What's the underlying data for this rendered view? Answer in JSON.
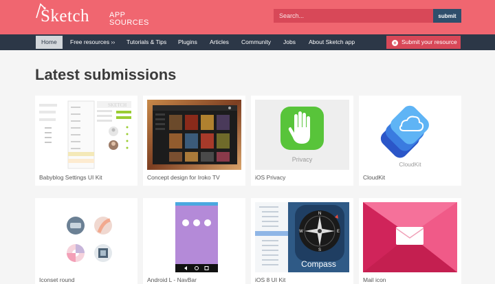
{
  "header": {
    "logo": {
      "word": "Sketch",
      "sub1": "APP",
      "sub2": "SOURCES"
    },
    "search_placeholder": "Search...",
    "search_button": "submit"
  },
  "nav": {
    "items": [
      "Home",
      "Free resources ››",
      "Tutorials & Tips",
      "Plugins",
      "Articles",
      "Community",
      "Jobs",
      "About Sketch app"
    ],
    "submit_resource": "Submit your resource"
  },
  "main": {
    "title": "Latest submissions",
    "cards": [
      {
        "label": "Babyblog Settings UI Kit"
      },
      {
        "label": "Concept design for Iroko TV"
      },
      {
        "label": "iOS Privacy",
        "thumb_text": "Privacy"
      },
      {
        "label": "CloudKit",
        "thumb_text": "CloudKit"
      },
      {
        "label": "Iconset round"
      },
      {
        "label": "Android L - NavBar"
      },
      {
        "label": "iOS 8 UI Kit",
        "thumb_text": "Compass"
      },
      {
        "label": "Mail icon"
      }
    ]
  },
  "colors": {
    "header_bg": "#f06670",
    "nav_bg": "#2c3747",
    "accent_red": "#d84858",
    "submit_blue": "#2f4f6c",
    "privacy_green": "#58c43a",
    "cloudkit_blue": "#4ea3f0",
    "android_purple": "#b48ad8",
    "mail_pink": "#e8326a"
  },
  "icons": {
    "logo": "sketch-diamond-icon",
    "submit_resource": "plus-circle-icon",
    "privacy": "hand-icon",
    "cloudkit": "cloud-icon",
    "compass": "compass-icon",
    "mail": "envelope-icon"
  }
}
